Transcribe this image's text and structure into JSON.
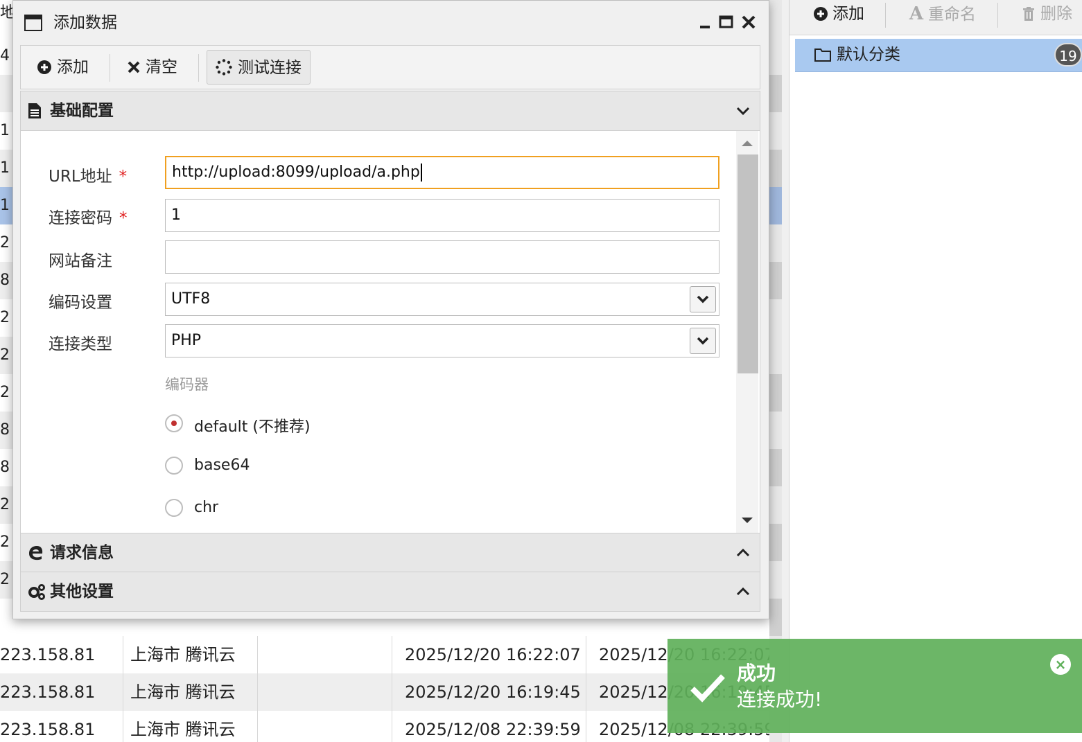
{
  "background_table": {
    "edge_digits": [
      "地",
      "4",
      "1",
      "1",
      "1",
      "1",
      "2",
      "8",
      "2",
      "2",
      "2",
      "8",
      "8",
      "2",
      "2",
      "2"
    ],
    "rows": [
      {
        "ip": "223.158.81",
        "location": "上海市 腾讯云",
        "created": "2025/12/20 16:22:07",
        "updated": "2025/12/20 16:22:07"
      },
      {
        "ip": "223.158.81",
        "location": "上海市 腾讯云",
        "created": "2025/12/20 16:19:45",
        "updated": "2025/12/20 16:19:45"
      },
      {
        "ip": "223.158.81",
        "location": "上海市 腾讯云",
        "created": "2025/12/08 22:39:59",
        "updated": "2025/12/08 22:39:59"
      }
    ]
  },
  "right_panel": {
    "toolbar": {
      "add": "添加",
      "rename": "重命名",
      "delete": "删除"
    },
    "category": {
      "label": "默认分类",
      "count": "19"
    }
  },
  "dialog": {
    "title": "添加数据",
    "toolbar": {
      "add": "添加",
      "clear": "清空",
      "test": "测试连接"
    },
    "sections": {
      "basic": "基础配置",
      "request": "请求信息",
      "other": "其他设置"
    },
    "form": {
      "url_label": "URL地址",
      "url_value": "http://upload:8099/upload/a.php",
      "password_label": "连接密码",
      "password_value": "1",
      "note_label": "网站备注",
      "note_value": "",
      "encoding_label": "编码设置",
      "encoding_value": "UTF8",
      "type_label": "连接类型",
      "type_value": "PHP",
      "required_mark": "*",
      "encoder_group": "编码器",
      "encoders": [
        {
          "label": "default (不推荐)",
          "selected": true
        },
        {
          "label": "base64",
          "selected": false
        },
        {
          "label": "chr",
          "selected": false
        }
      ]
    }
  },
  "toast": {
    "title": "成功",
    "message": "连接成功!",
    "color": "#5fb05a"
  }
}
